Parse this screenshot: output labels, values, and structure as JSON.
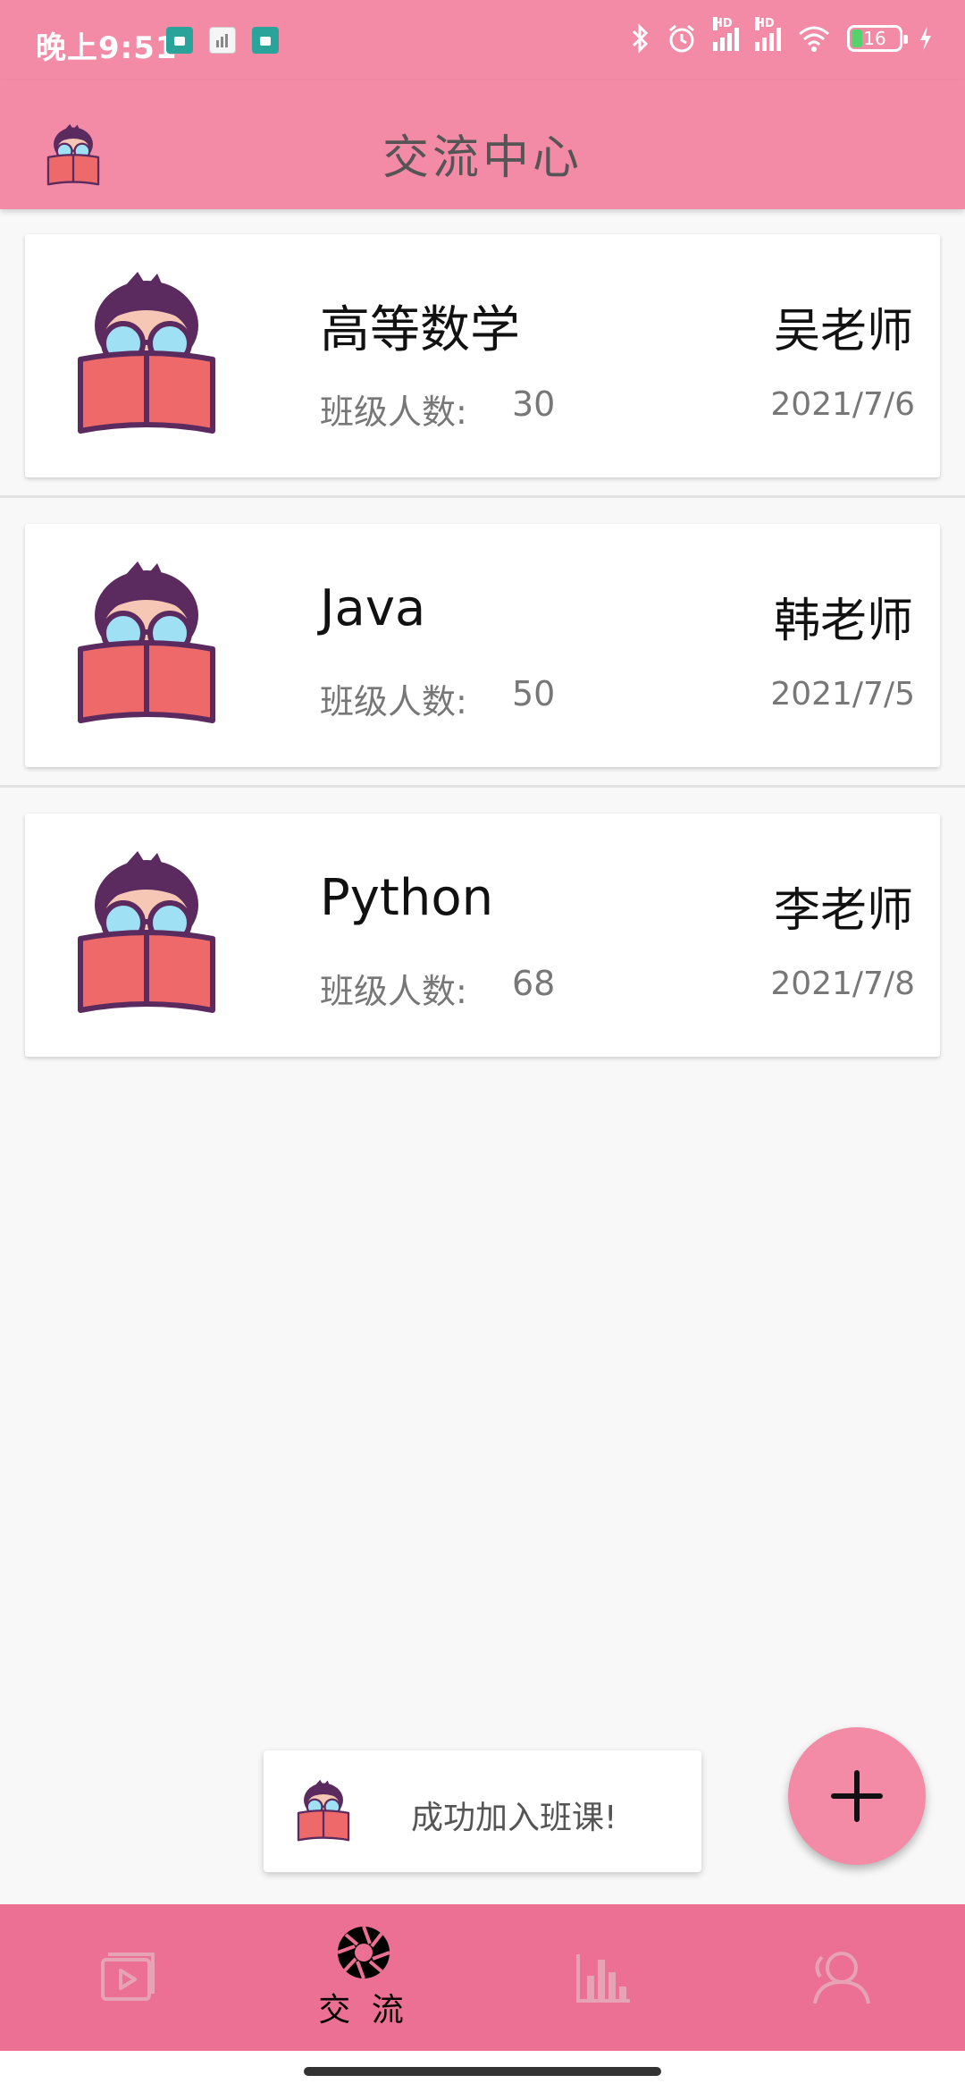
{
  "status_bar": {
    "time": "晚上9:51",
    "battery": "16"
  },
  "app_bar": {
    "title": "交流中心"
  },
  "classes": [
    {
      "course": "高等数学",
      "count_label": "班级人数:",
      "count": "30",
      "teacher": "吴老师",
      "date": "2021/7/6"
    },
    {
      "course": "Java",
      "count_label": "班级人数:",
      "count": "50",
      "teacher": "韩老师",
      "date": "2021/7/5"
    },
    {
      "course": "Python",
      "count_label": "班级人数:",
      "count": "68",
      "teacher": "李老师",
      "date": "2021/7/8"
    }
  ],
  "toast": {
    "text": "成功加入班课!"
  },
  "bottom_nav": {
    "active_label": "交 流"
  },
  "icons": {
    "mascot": "reading-mascot-icon",
    "fab": "plus-icon",
    "nav": [
      "video-icon",
      "aperture-icon",
      "bar-chart-icon",
      "users-icon"
    ]
  },
  "colors": {
    "primary": "#f38aa6",
    "nav_bg": "#ec7094",
    "book": "#ee6a6a"
  }
}
